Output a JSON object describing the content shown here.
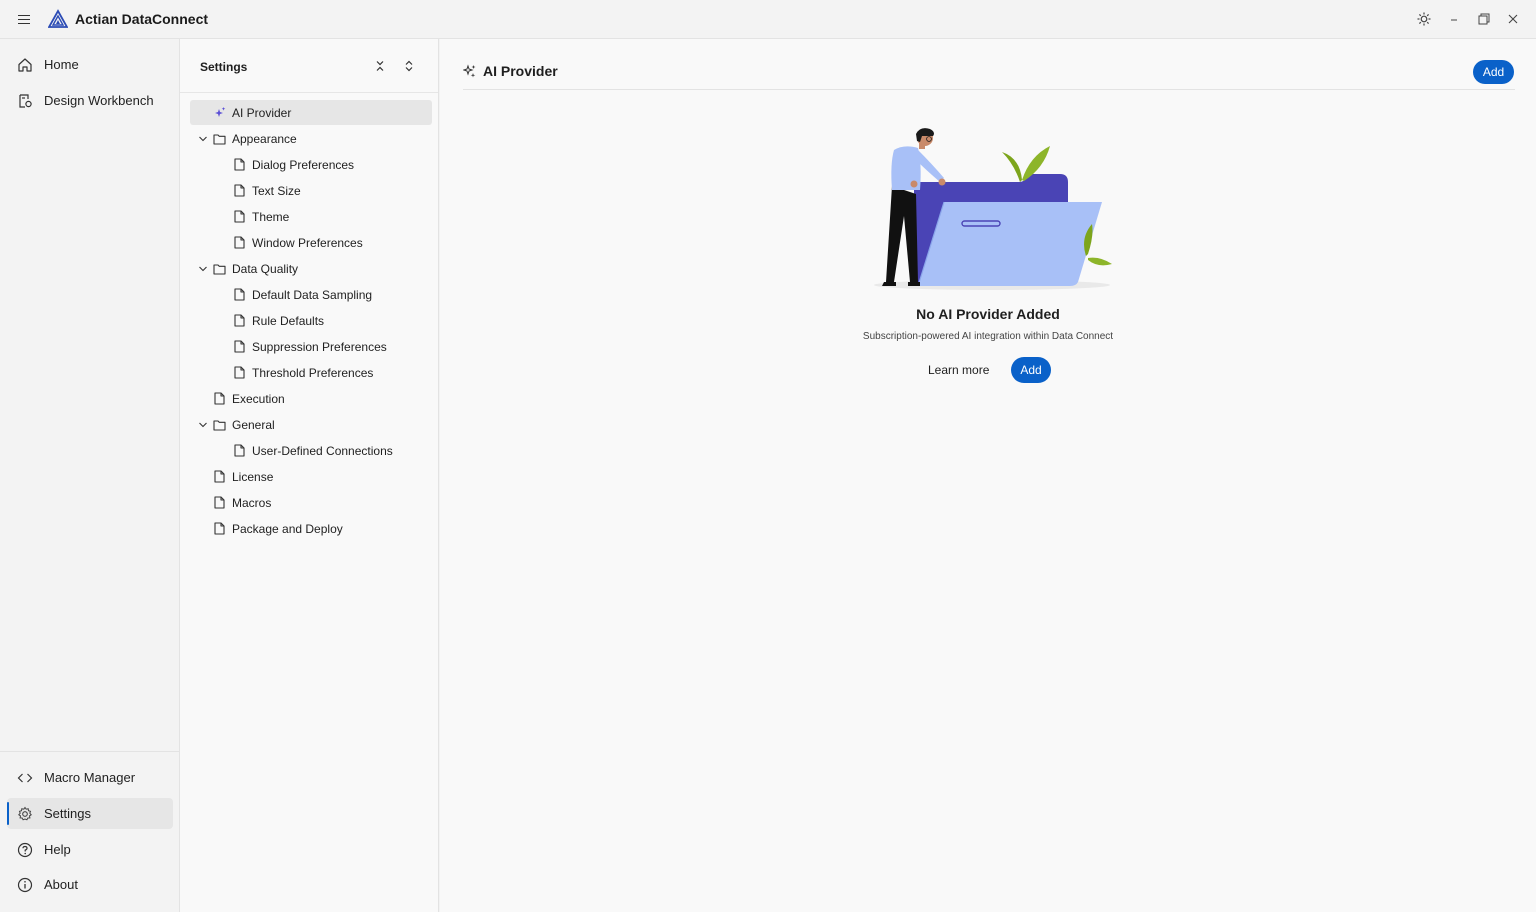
{
  "app": {
    "title": "Actian DataConnect"
  },
  "titlebar": {
    "theme_icon": "sun-icon",
    "minimize_icon": "minimize-icon",
    "maximize_icon": "restore-icon",
    "close_icon": "close-icon"
  },
  "nav": {
    "top": [
      {
        "label": "Home",
        "icon": "home-icon"
      },
      {
        "label": "Design Workbench",
        "icon": "workbench-icon"
      }
    ],
    "bottom": [
      {
        "label": "Macro Manager",
        "icon": "code-icon"
      },
      {
        "label": "Settings",
        "icon": "gear-icon",
        "active": true
      },
      {
        "label": "Help",
        "icon": "help-icon"
      },
      {
        "label": "About",
        "icon": "info-icon"
      }
    ]
  },
  "settings_tree": {
    "title": "Settings",
    "items": [
      {
        "label": "AI Provider",
        "level": 0,
        "type": "ai"
      },
      {
        "label": "Appearance",
        "level": 0,
        "type": "folder"
      },
      {
        "label": "Dialog Preferences",
        "level": 1,
        "type": "file"
      },
      {
        "label": "Text Size",
        "level": 1,
        "type": "file"
      },
      {
        "label": "Theme",
        "level": 1,
        "type": "file"
      },
      {
        "label": "Window Preferences",
        "level": 1,
        "type": "file"
      },
      {
        "label": "Data Quality",
        "level": 0,
        "type": "folder"
      },
      {
        "label": "Default Data Sampling",
        "level": 1,
        "type": "file"
      },
      {
        "label": "Rule Defaults",
        "level": 1,
        "type": "file"
      },
      {
        "label": "Suppression Preferences",
        "level": 1,
        "type": "file"
      },
      {
        "label": "Threshold Preferences",
        "level": 1,
        "type": "file"
      },
      {
        "label": "Execution",
        "level": 0,
        "type": "file"
      },
      {
        "label": "General",
        "level": 0,
        "type": "folder"
      },
      {
        "label": "User-Defined Connections",
        "level": 1,
        "type": "file"
      },
      {
        "label": "License",
        "level": 0,
        "type": "file"
      },
      {
        "label": "Macros",
        "level": 0,
        "type": "file"
      },
      {
        "label": "Package and Deploy",
        "level": 0,
        "type": "file"
      }
    ]
  },
  "main": {
    "title": "AI Provider",
    "add_label": "Add",
    "empty": {
      "title": "No AI Provider Added",
      "subtitle": "Subscription-powered AI integration within Data Connect",
      "learn_more": "Learn more",
      "add_label": "Add"
    }
  },
  "colors": {
    "accent": "#0a61c9",
    "folder_back": "#4a44b5",
    "folder_front": "#a8c0f7",
    "leaf": "#7da51c"
  }
}
